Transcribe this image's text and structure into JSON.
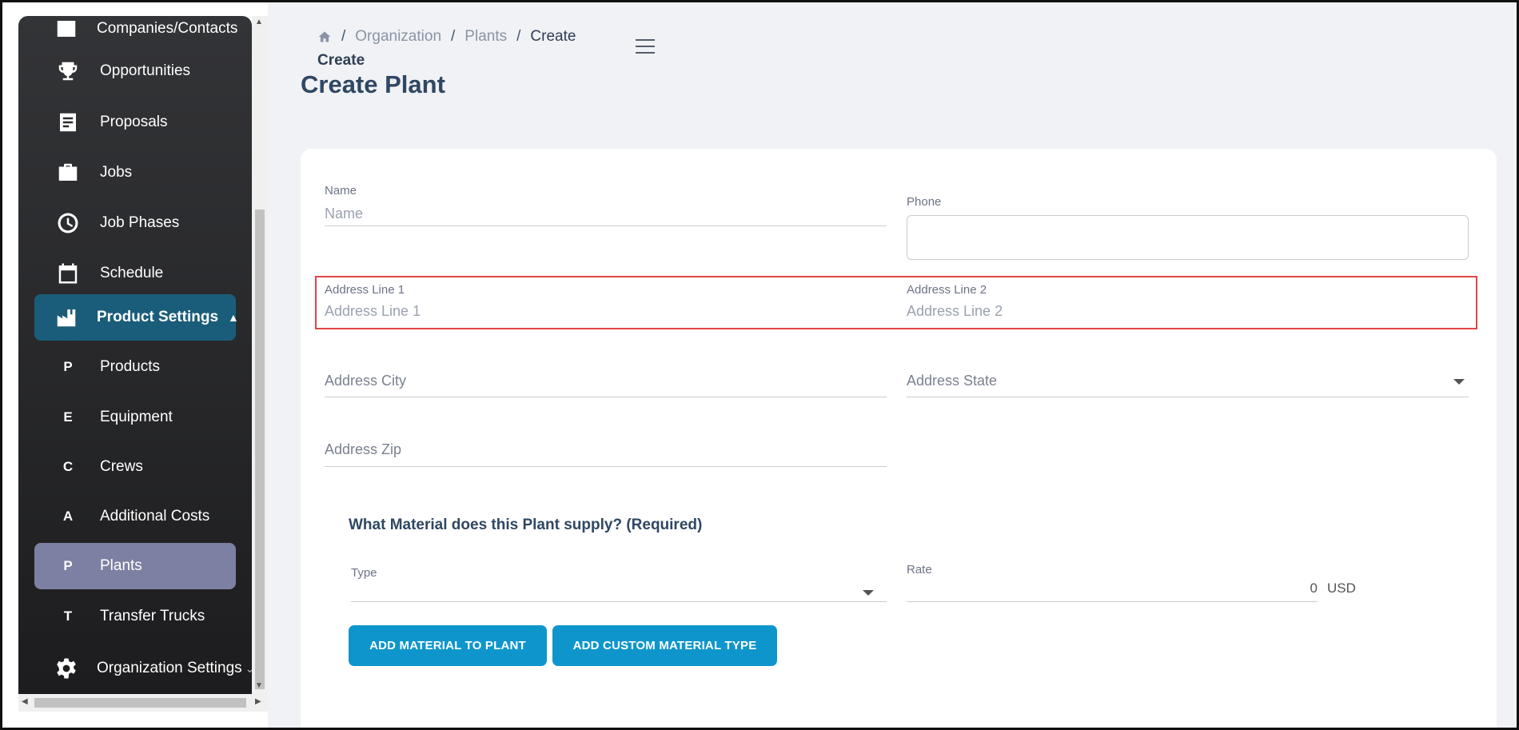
{
  "sidebar": {
    "items": [
      {
        "label": "Companies/Contacts",
        "icon": "building-icon"
      },
      {
        "label": "Opportunities",
        "icon": "trophy-icon"
      },
      {
        "label": "Proposals",
        "icon": "document-icon"
      },
      {
        "label": "Jobs",
        "icon": "briefcase-icon"
      },
      {
        "label": "Job Phases",
        "icon": "clock-icon"
      },
      {
        "label": "Schedule",
        "icon": "calendar-icon"
      },
      {
        "label": "Product Settings",
        "icon": "factory-icon"
      },
      {
        "label": "Products",
        "letter": "P"
      },
      {
        "label": "Equipment",
        "letter": "E"
      },
      {
        "label": "Crews",
        "letter": "C"
      },
      {
        "label": "Additional Costs",
        "letter": "A"
      },
      {
        "label": "Plants",
        "letter": "P"
      },
      {
        "label": "Transfer Trucks",
        "letter": "T"
      },
      {
        "label": "Organization Settings",
        "icon": "gear-icon"
      }
    ]
  },
  "breadcrumb": {
    "items": [
      "Organization",
      "Plants",
      "Create"
    ],
    "separator": "/",
    "sub": "Create"
  },
  "page": {
    "title": "Create Plant"
  },
  "form": {
    "name": {
      "label": "Name",
      "placeholder": "Name"
    },
    "phone": {
      "label": "Phone",
      "value": ""
    },
    "address1": {
      "label": "Address Line 1",
      "placeholder": "Address Line 1"
    },
    "address2": {
      "label": "Address Line 2",
      "placeholder": "Address Line 2"
    },
    "city": {
      "placeholder": "Address City"
    },
    "state": {
      "placeholder": "Address State"
    },
    "zip": {
      "placeholder": "Address Zip"
    }
  },
  "material": {
    "title": "What Material does this Plant supply? (Required)",
    "type_label": "Type",
    "rate_label": "Rate",
    "rate_value": "0",
    "currency": "USD",
    "add_button": "ADD MATERIAL TO PLANT",
    "custom_button": "ADD CUSTOM MATERIAL TYPE"
  },
  "colors": {
    "accent": "#0e96cc",
    "active_parent": "#1a5d7a",
    "active_child": "#7c81a3",
    "highlight": "#e04545"
  }
}
